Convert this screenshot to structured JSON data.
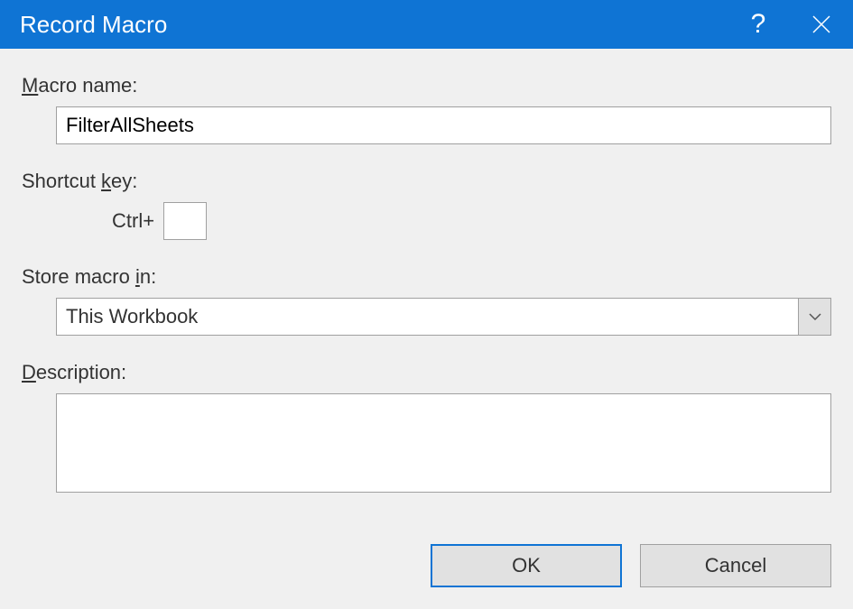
{
  "titlebar": {
    "title": "Record Macro",
    "help_glyph": "?",
    "close_glyph": "✕"
  },
  "fields": {
    "macro_name": {
      "label_pre": "M",
      "label_post": "acro name:",
      "value": "FilterAllSheets"
    },
    "shortcut": {
      "label_pre": "Shortcut ",
      "label_u": "k",
      "label_post": "ey:",
      "prefix": "Ctrl+",
      "value": ""
    },
    "store": {
      "label_pre": "Store macro ",
      "label_u": "i",
      "label_post": "n:",
      "selected": "This Workbook"
    },
    "description": {
      "label_u": "D",
      "label_post": "escription:",
      "value": ""
    }
  },
  "buttons": {
    "ok": "OK",
    "cancel": "Cancel"
  }
}
